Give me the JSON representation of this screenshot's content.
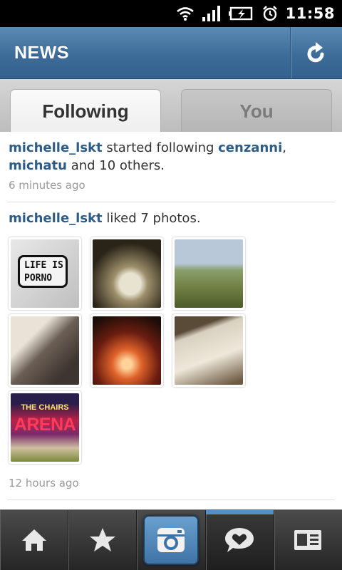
{
  "status_bar": {
    "time": "11:58",
    "icons": [
      "wifi-icon",
      "signal-icon",
      "battery-charging-icon",
      "alarm-icon"
    ]
  },
  "app_bar": {
    "title": "NEWS",
    "refresh_icon": "refresh-icon"
  },
  "tabs": [
    {
      "label": "Following",
      "selected": true
    },
    {
      "label": "You",
      "selected": false
    }
  ],
  "feed": [
    {
      "user": "michelle_lskt",
      "action": " started following ",
      "targets": [
        "cenzanni",
        "michatu"
      ],
      "separator": ",",
      "suffix": " and 10 others.",
      "time": "6 minutes ago"
    },
    {
      "user": "michelle_lskt",
      "action": " liked 7 photos.",
      "photos": [
        {
          "name": "life-is-porno-photo",
          "text": "LIFE IS PORNO"
        },
        {
          "name": "glass-vases-photo"
        },
        {
          "name": "park-shoes-photo"
        },
        {
          "name": "wine-bar-photo"
        },
        {
          "name": "sunset-building-photo"
        },
        {
          "name": "paper-closeup-photo"
        },
        {
          "name": "the-chairs-arena-photo",
          "text_top": "THE CHAIRS",
          "text_main": "ARENA"
        }
      ],
      "time": "12 hours ago"
    }
  ],
  "bottom_nav": [
    {
      "name": "home",
      "icon": "home-icon"
    },
    {
      "name": "popular",
      "icon": "star-icon"
    },
    {
      "name": "camera",
      "icon": "camera-icon"
    },
    {
      "name": "news",
      "icon": "heart-bubble-icon",
      "active": true
    },
    {
      "name": "profile",
      "icon": "profile-card-icon"
    }
  ],
  "colors": {
    "appbar_blue": "#3d6c99",
    "username_blue": "#2d5d87",
    "active_tab_indicator": "#5590c4"
  }
}
